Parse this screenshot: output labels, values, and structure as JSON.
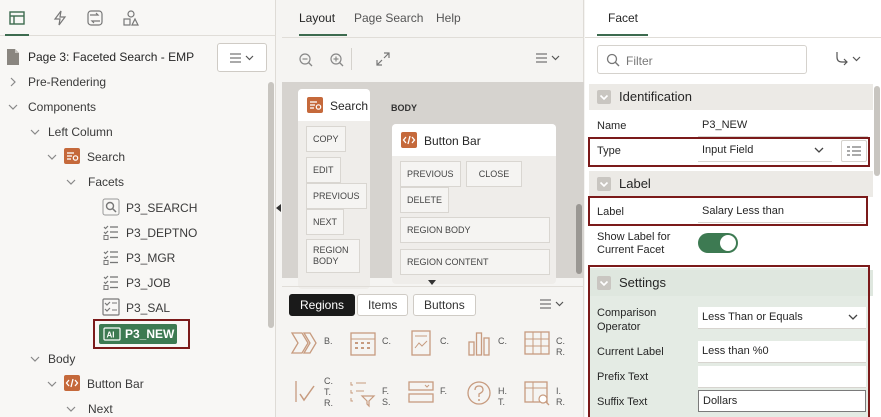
{
  "left": {
    "page_title": "Page 3: Faceted Search - EMP",
    "tree": {
      "pre_rendering": "Pre-Rendering",
      "components": "Components",
      "left_column": "Left Column",
      "search": "Search",
      "facets": "Facets",
      "p3_search": "P3_SEARCH",
      "p3_deptno": "P3_DEPTNO",
      "p3_mgr": "P3_MGR",
      "p3_job": "P3_JOB",
      "p3_sal": "P3_SAL",
      "p3_new": "P3_NEW",
      "body": "Body",
      "button_bar": "Button Bar",
      "next": "Next"
    }
  },
  "middle": {
    "tabs": [
      "Layout",
      "Page Search",
      "Help"
    ],
    "search_region": "Search",
    "search_pills": [
      "COPY",
      "EDIT",
      "PREVIOUS",
      "NEXT",
      "REGION BODY"
    ],
    "body_label": "BODY",
    "button_bar_region": "Button Bar",
    "button_bar_pills": [
      "PREVIOUS",
      "CLOSE",
      "DELETE"
    ],
    "region_body": "REGION BODY",
    "region_content": "REGION CONTENT",
    "gallery_tabs": [
      "Regions",
      "Items",
      "Buttons"
    ],
    "gallery_labels": [
      "B.",
      "C.",
      "C.",
      "C.",
      "C. R.",
      "C. T. R.",
      "F. S.",
      "F.",
      "H. T.",
      "I. R."
    ]
  },
  "right": {
    "tab": "Facet",
    "filter_placeholder": "Filter",
    "identification": {
      "heading": "Identification",
      "name_label": "Name",
      "name_value": "P3_NEW",
      "type_label": "Type",
      "type_value": "Input Field"
    },
    "label_section": {
      "heading": "Label",
      "label_label": "Label",
      "label_value": "Salary Less than",
      "show_label": "Show Label for Current Facet"
    },
    "settings": {
      "heading": "Settings",
      "comparison_label": "Comparison Operator",
      "comparison_value": "Less Than or Equals",
      "current_label_label": "Current Label",
      "current_label_value": "Less than %0",
      "prefix_label": "Prefix Text",
      "prefix_value": "",
      "suffix_label": "Suffix Text",
      "suffix_value": "Dollars"
    }
  },
  "colors": {
    "accent_green": "#3d7a52",
    "highlight_border": "#7b1a1a",
    "icon_orange": "#c5693b"
  }
}
